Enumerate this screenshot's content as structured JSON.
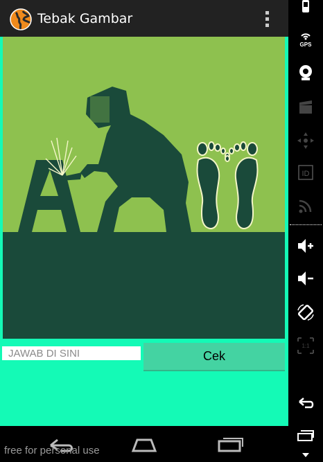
{
  "app": {
    "title": "Tebak Gambar",
    "icon": "globe-icon",
    "menu_icon": "overflow-menu-icon"
  },
  "puzzle": {
    "picture": "welder-letter-a-footprints",
    "letter": "A"
  },
  "answer": {
    "placeholder": "JAWAB DI SINI",
    "value": ""
  },
  "buttons": {
    "check_label": "Cek"
  },
  "navigation": {
    "back_icon": "back-icon",
    "home_icon": "home-icon",
    "recents_icon": "recents-icon"
  },
  "emulator": {
    "gps_label": "GPS",
    "id_label": "ID",
    "scale_label": "1:1"
  },
  "watermark": "free for personal use",
  "colors": {
    "actionbar": "#222222",
    "content_bg": "#14fab6",
    "picture_bg": "#8ec14f",
    "dark_green": "#1a4a3a",
    "button": "#44d3a2"
  }
}
